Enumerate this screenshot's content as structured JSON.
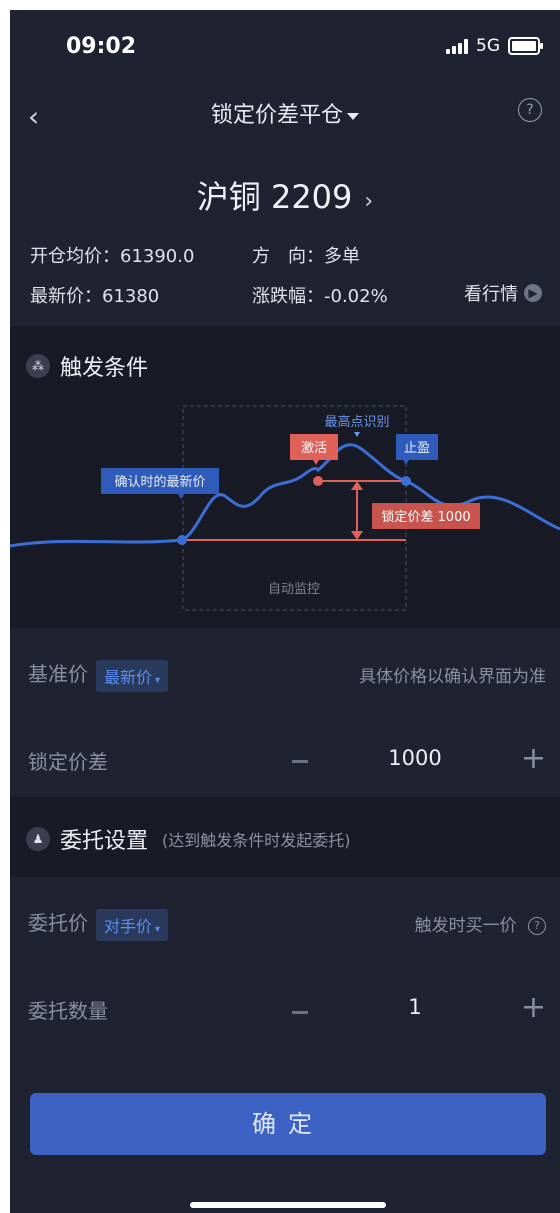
{
  "status": {
    "time": "09:02",
    "network": "5G"
  },
  "nav": {
    "back": "‹",
    "title": "锁定价差平仓",
    "help": "?"
  },
  "contract": {
    "name": "沪铜 2209",
    "chevron": "›"
  },
  "info": {
    "open_avg_label": "开仓均价：",
    "open_avg": "61390.0",
    "direction_label": "方　向：",
    "direction": "多单",
    "latest_label": "最新价：",
    "latest": "61380",
    "change_label": "涨跌幅：",
    "change": "-0.02%",
    "market_link": "看行情"
  },
  "trigger": {
    "title": "触发条件",
    "diagram": {
      "latest_price": "确认时的最新价",
      "peak": "最高点识别",
      "activate": "激活",
      "take_profit": "止盈",
      "lock_spread": "锁定价差 1000",
      "auto_monitor": "自动监控"
    }
  },
  "base_price": {
    "label": "基准价",
    "option": "最新价",
    "hint": "具体价格以确认界面为准"
  },
  "lock_spread": {
    "label": "锁定价差",
    "value": "1000"
  },
  "order": {
    "title": "委托设置",
    "subtitle": "(达到触发条件时发起委托)"
  },
  "order_price": {
    "label": "委托价",
    "option": "对手价",
    "hint": "触发时买一价"
  },
  "order_qty": {
    "label": "委托数量",
    "value": "1"
  },
  "confirm": "确定",
  "colors": {
    "accent": "#3c63c4",
    "red": "#e0605a",
    "blue_line": "#3b6fd6"
  }
}
